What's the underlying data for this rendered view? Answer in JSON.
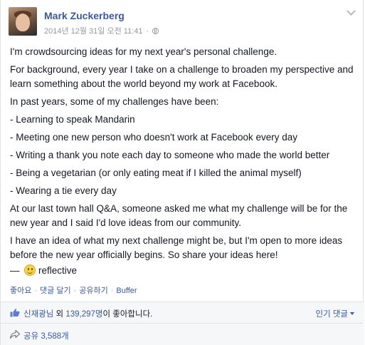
{
  "post": {
    "author": "Mark Zuckerberg",
    "timestamp": "2014년 12월 31일 오전 11:41",
    "meta_separator": "·",
    "privacy_icon": "globe-icon",
    "menu_icon": "chevron-down-icon",
    "paragraphs": [
      "I'm crowdsourcing ideas for my next year's personal challenge.",
      "For background, every year I take on a challenge to broaden my perspective and learn something about the world beyond my work at Facebook.",
      "In past years, some of my challenges have been:",
      "- Learning to speak Mandarin",
      "- Meeting one new person who doesn't work at Facebook every day",
      "- Writing a thank you note each day to someone who made the world better",
      "- Being a vegetarian (or only eating meat if I killed the animal myself)",
      "- Wearing a tie every day",
      "At our last town hall Q&A, someone asked me what my challenge will be for the new year and I said I'd love ideas from our community.",
      "I have an idea of what my next challenge might be, but I'm open to more ideas before the new year officially begins. So share your ideas here!"
    ],
    "feeling_prefix": "—",
    "feeling_icon": "smiley-icon",
    "feeling": "reflective"
  },
  "actions": {
    "like": "좋아요",
    "comment": "댓글 달기",
    "share": "공유하기",
    "buffer": "Buffer",
    "separator": "·"
  },
  "footer": {
    "likes_icon": "thumbs-up-icon",
    "likes_name": "신재광님",
    "likes_middle": " 외 ",
    "likes_count": "139,297명",
    "likes_suffix": "이 좋아합니다.",
    "sort_comments": "인기 댓글",
    "shares_icon": "share-arrow-icon",
    "shares": "공유 3,588개"
  },
  "colors": {
    "link": "#3b5998",
    "text": "#141823",
    "meta": "#9197a3",
    "footer_bg": "#f6f7f8"
  }
}
